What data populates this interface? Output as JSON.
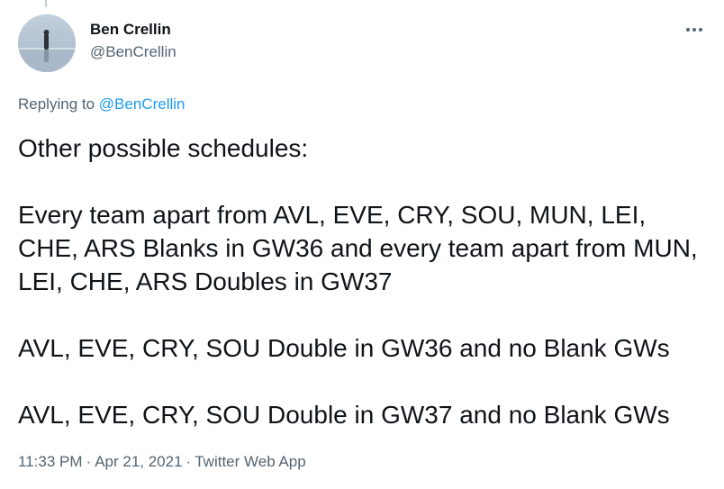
{
  "tweet": {
    "author": {
      "display_name": "Ben Crellin",
      "handle": "@BenCrellin",
      "avatar_icon": "profile-photo-person-standing-on-reflective-beach"
    },
    "more_icon": "more-horizontal-icon",
    "replying": {
      "prefix": "Replying to",
      "handle": "@BenCrellin"
    },
    "paragraphs": [
      "Other possible schedules:",
      "Every team apart from AVL, EVE, CRY, SOU, MUN, LEI, CHE, ARS Blanks in GW36 and every team apart from MUN, LEI, CHE, ARS Doubles in GW37",
      "AVL, EVE, CRY, SOU Double in GW36 and no Blank GWs",
      "AVL, EVE, CRY, SOU Double in GW37 and no Blank GWs"
    ],
    "meta": {
      "time": "11:33 PM",
      "separator": "·",
      "date": "Apr 21, 2021",
      "source": "Twitter Web App"
    },
    "colors": {
      "text": "#0f1419",
      "secondary": "#536471",
      "link": "#1d9bf0",
      "thread_line": "#c4cfd6"
    }
  }
}
